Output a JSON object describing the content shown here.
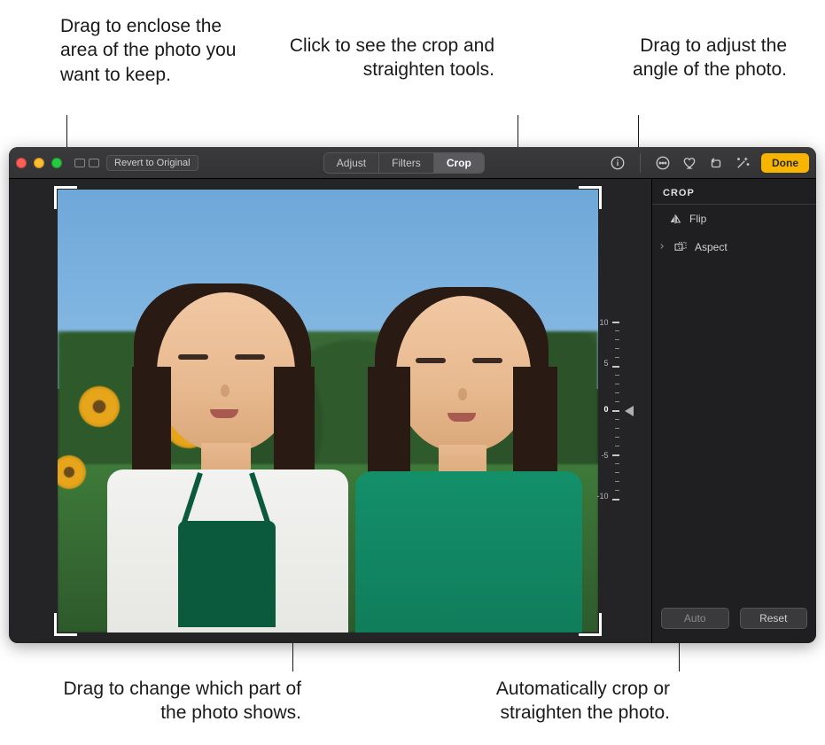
{
  "callouts": {
    "top_left": "Drag to enclose the area of the photo you want to keep.",
    "top_center": "Click to see the crop and straighten tools.",
    "top_right": "Drag to adjust the angle of the photo.",
    "bottom_left": "Drag to change which part of the photo shows.",
    "bottom_right": "Automatically crop or straighten the photo."
  },
  "toolbar": {
    "revert_label": "Revert to Original",
    "tabs": {
      "adjust": "Adjust",
      "filters": "Filters",
      "crop": "Crop"
    },
    "done_label": "Done"
  },
  "panel": {
    "title": "CROP",
    "flip_label": "Flip",
    "aspect_label": "Aspect",
    "auto_label": "Auto",
    "reset_label": "Reset"
  },
  "dial": {
    "labels": {
      "p10": "10",
      "p5": "5",
      "zero": "0",
      "m5": "-5",
      "m10": "-10"
    },
    "current": "0"
  }
}
